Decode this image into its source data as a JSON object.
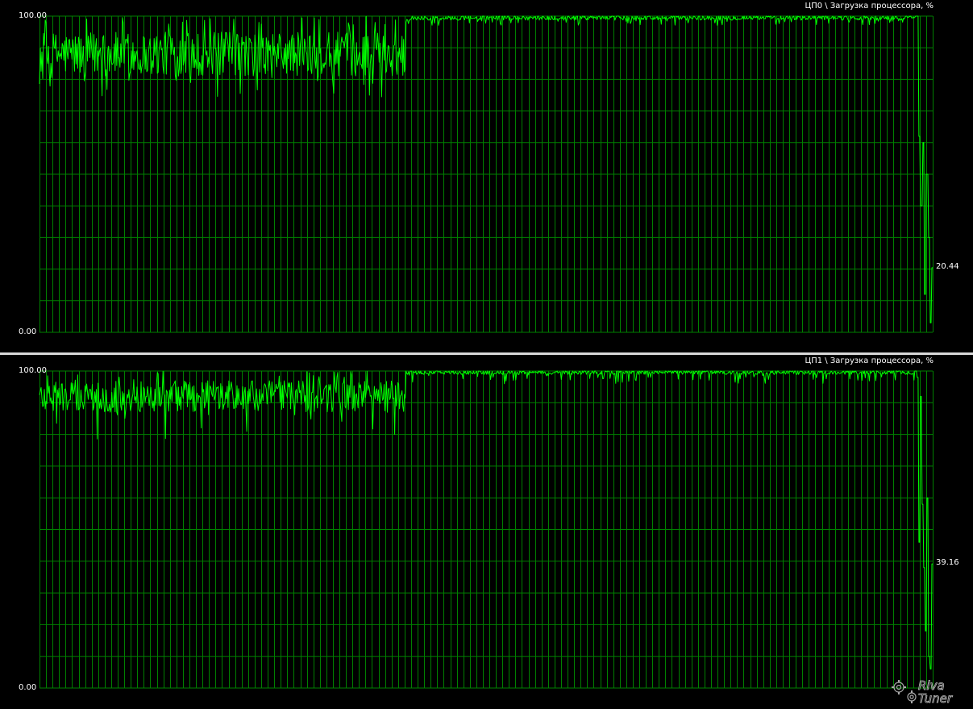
{
  "chart_data": [
    {
      "type": "line",
      "title": "ЦП0 \\ Загрузка процессора, %",
      "ymax_label": "100.00",
      "ymin_label": "0.00",
      "current_label": "20.44",
      "current_value": 20.44,
      "ylim": [
        0,
        100
      ],
      "grid": true,
      "line_color": "#00ff00",
      "grid_color": "#008000",
      "segments": [
        {
          "from": 0.0,
          "to": 0.41,
          "mean": 88,
          "spread": 7,
          "dip_min": 74,
          "peak_max": 100
        },
        {
          "from": 0.41,
          "to": 0.98,
          "mean": 99.5,
          "spread": 0.8,
          "dip_min": 97,
          "peak_max": 100
        },
        {
          "from": 0.98,
          "to": 1.0,
          "points": [
            100,
            100,
            62,
            40,
            60,
            12,
            50,
            30,
            3,
            20.44
          ]
        }
      ]
    },
    {
      "type": "line",
      "title": "ЦП1 \\ Загрузка процессора, %",
      "ymax_label": "100.00",
      "ymin_label": "0.00",
      "current_label": "39.16",
      "current_value": 39.16,
      "ylim": [
        0,
        100
      ],
      "grid": true,
      "line_color": "#00ff00",
      "grid_color": "#008000",
      "segments": [
        {
          "from": 0.0,
          "to": 0.41,
          "mean": 92,
          "spread": 5,
          "dip_min": 78,
          "peak_max": 100
        },
        {
          "from": 0.41,
          "to": 0.98,
          "mean": 99.6,
          "spread": 0.7,
          "dip_min": 96,
          "peak_max": 100
        },
        {
          "from": 0.98,
          "to": 1.0,
          "points": [
            100,
            98,
            46,
            92,
            58,
            38,
            18,
            60,
            10,
            6,
            39.16
          ]
        }
      ]
    }
  ],
  "watermark": {
    "text": "RivaTuner"
  }
}
